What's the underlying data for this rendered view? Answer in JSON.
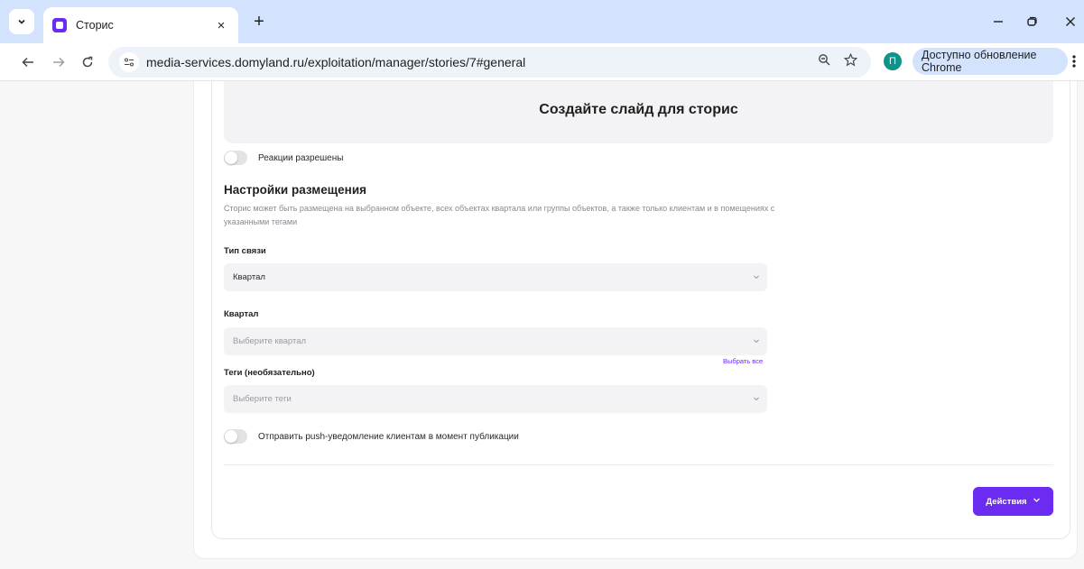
{
  "browser": {
    "tab": {
      "title": "Сторис",
      "close": "×"
    },
    "new_tab": "+",
    "url": "media-services.domyland.ru/exploitation/manager/stories/7#general",
    "profile_initial": "П",
    "update_label": "Доступно обновление Chrome",
    "icons": [
      "chevron-down-icon",
      "back-icon",
      "forward-icon",
      "reload-icon",
      "site-info-icon",
      "zoom-icon",
      "star-icon",
      "minimize-icon",
      "restore-icon",
      "close-icon",
      "more-icon"
    ]
  },
  "story": {
    "slide_placeholder": "Создайте слайд для сторис",
    "reactions_label": "Реакции разрешены",
    "reactions_enabled": false,
    "placement_title": "Настройки размещения",
    "placement_desc": "Сторис может быть размещена на выбранном объекте, всех объектах квартала или группы объектов, а также только клиентам и в помещениях с указанными тегами",
    "link_type": {
      "label": "Тип связи",
      "value": "Квартал"
    },
    "quarter": {
      "label": "Квартал",
      "placeholder": "Выберите квартал",
      "select_all": "Выбрать все"
    },
    "tags": {
      "label": "Теги (необязательно)",
      "placeholder": "Выберите теги"
    },
    "push_label": "Отправить push-уведомление клиентам в момент публикации",
    "push_enabled": false,
    "actions_label": "Действия"
  },
  "colors": {
    "accent": "#6b2bf0",
    "tabstrip": "#d3e3fd",
    "field_bg": "#f3f3f5"
  }
}
